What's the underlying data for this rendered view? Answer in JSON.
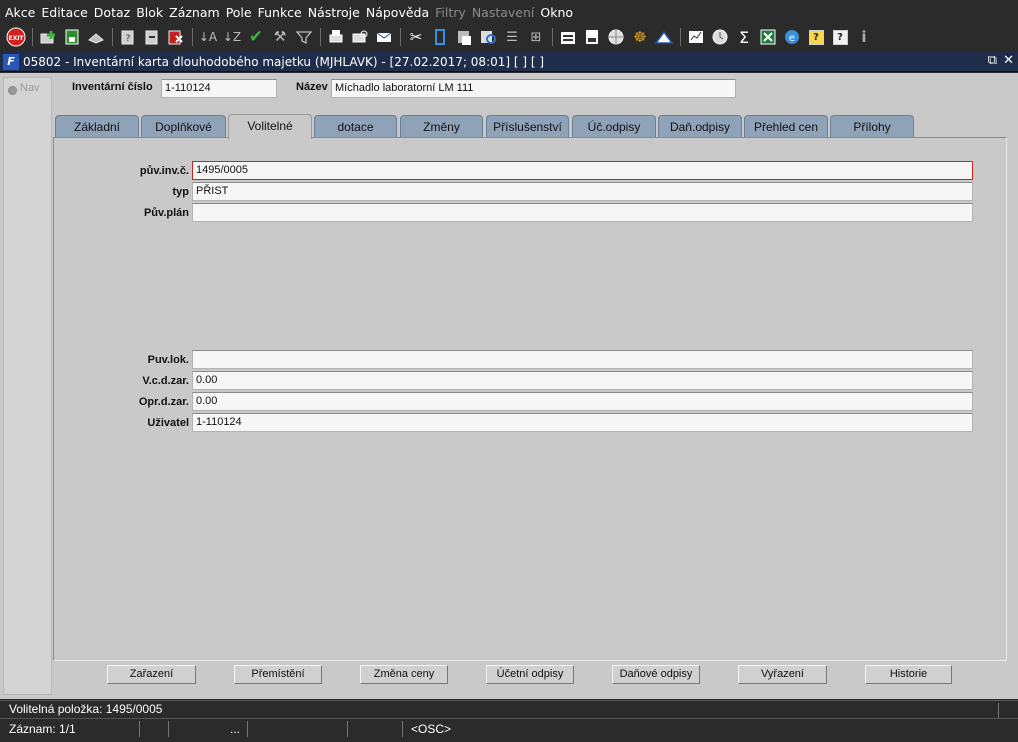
{
  "menu": [
    "Akce",
    "Editace",
    "Dotaz",
    "Blok",
    "Záznam",
    "Pole",
    "Funkce",
    "Nástroje",
    "Nápověda",
    "Filtry",
    "Nastavení",
    "Okno"
  ],
  "menu_disabled": [
    "Filtry",
    "Nastavení"
  ],
  "toolbar": {
    "exit_label": "EXIT",
    "icons": [
      "add-record-icon",
      "save-icon",
      "delete-icon",
      "query-icon",
      "query-run-icon",
      "cancel-query-icon",
      "sort-asc-icon",
      "sort-desc-icon",
      "commit-check-icon",
      "wrench-icon",
      "filter-icon",
      "print-icon",
      "print-preview-icon",
      "mail-icon",
      "cut-icon",
      "copy-icon",
      "paste-icon",
      "lov-icon",
      "list-icon",
      "tree-icon",
      "export-icon",
      "document-icon",
      "globe-icon",
      "steering-icon",
      "triangle-icon",
      "chart-icon",
      "clock-icon",
      "sum-icon",
      "excel-icon",
      "ie-icon",
      "help-icon",
      "context-help-icon",
      "info-icon"
    ]
  },
  "window": {
    "title": "05802 - Inventární karta dlouhodobého majetku (MJHLAVK) - [27.02.2017; 08:01]  [ ]  [ ]",
    "logo": "F"
  },
  "nav": {
    "label": "Nav"
  },
  "header": {
    "inv_label": "Inventární číslo",
    "inv_value": "1-110124",
    "name_label": "Název",
    "name_value": "Míchadlo laboratorní LM 111"
  },
  "tabs": [
    "Základní",
    "Doplňkové",
    "Volitelné",
    "dotace",
    "Změny",
    "Příslušenství",
    "Úč.odpisy",
    "Daň.odpisy",
    "Přehled cen",
    "Přílohy"
  ],
  "active_tab": "Volitelné",
  "form": {
    "puv_inv_label": "pův.inv.č.",
    "puv_inv_value": "1495/0005",
    "typ_label": "typ",
    "typ_value": "PŘIST",
    "puv_plan_label": "Pův.plán",
    "puv_plan_value": "",
    "puv_lok_label": "Puv.lok.",
    "puv_lok_value": "",
    "vcd_label": "V.c.d.zar.",
    "vcd_value": "0.00",
    "opr_label": "Opr.d.zar.",
    "opr_value": "0.00",
    "uzivatel_label": "Uživatel",
    "uzivatel_value": "1-110124"
  },
  "buttons": [
    "Zařazení",
    "Přemístění",
    "Změna ceny",
    "Účetní odpisy",
    "Daňové odpisy",
    "Vyřazení",
    "Historie"
  ],
  "status": {
    "message": "Volitelná položka: 1495/0005",
    "record": "Záznam: 1/1",
    "ellipsis": "...",
    "mode": "<OSC>"
  },
  "colors": {
    "active_field_border": "#cc2222",
    "tab_bg": "#8fa3b8",
    "title_bg": "#1f2d4a"
  }
}
